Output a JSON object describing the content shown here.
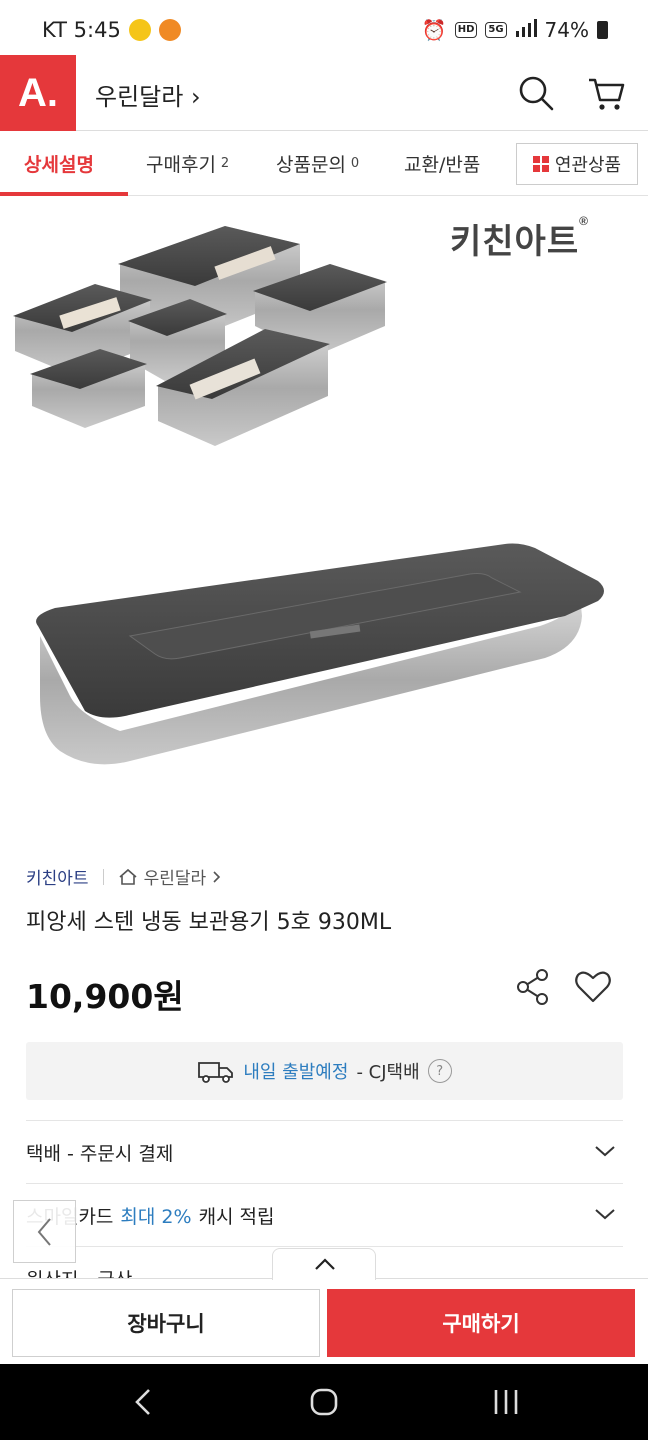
{
  "status_bar": {
    "carrier_time": "KT 5:45",
    "signal_5g": "5G",
    "hd_label": "HD",
    "battery_pct": "74%"
  },
  "header": {
    "logo_text": "A.",
    "store_name": "우린달라 ›"
  },
  "tabs": [
    {
      "label": "상세설명",
      "count": ""
    },
    {
      "label": "구매후기",
      "count": "2"
    },
    {
      "label": "상품문의",
      "count": "0"
    },
    {
      "label": "교환/반품",
      "count": ""
    }
  ],
  "related_button": "연관상품",
  "hero": {
    "brand_logo": "키친아트"
  },
  "product": {
    "brand": "키친아트",
    "store": "우린달라",
    "title": "피앙세 스텐 냉동 보관용기 5호 930ML",
    "price": "10,900원"
  },
  "delivery": {
    "highlight": "내일 출발예정",
    "rest": "- CJ택배",
    "help": "?"
  },
  "info_rows": [
    {
      "prefix": "택배 - 주문시 결제",
      "highlight": "",
      "suffix": ""
    },
    {
      "prefix": "스마일카드",
      "highlight": "최대 2%",
      "suffix": "캐시 적립"
    },
    {
      "prefix": "원산지 - 국산",
      "highlight": "",
      "suffix": ""
    }
  ],
  "bottom": {
    "cart": "장바구니",
    "buy": "구매하기"
  },
  "colors": {
    "brand_red": "#e5383b",
    "link_blue": "#2d7dbf",
    "brand_navy": "#2b3f84"
  },
  "icons": [
    "search-icon",
    "cart-icon",
    "home-icon",
    "share-icon",
    "heart-icon",
    "truck-icon",
    "chevron-down-icon",
    "chevron-left-icon",
    "chevron-up-icon"
  ]
}
